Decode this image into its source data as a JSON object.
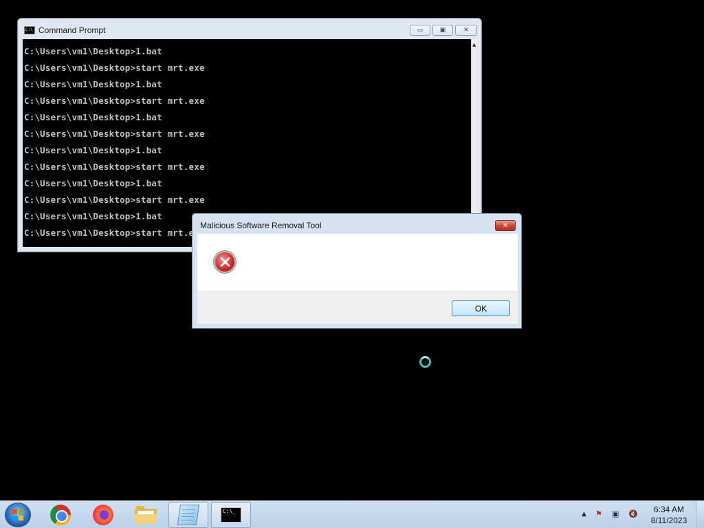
{
  "cmd_window": {
    "title": "Command Prompt",
    "icon_label": "C:\\",
    "buttons": {
      "minimize": "▭",
      "maximize": "▣",
      "close": "✕"
    },
    "lines": [
      "C:\\Users\\vm1\\Desktop>1.bat",
      "C:\\Users\\vm1\\Desktop>start mrt.exe",
      "C:\\Users\\vm1\\Desktop>1.bat",
      "C:\\Users\\vm1\\Desktop>start mrt.exe",
      "C:\\Users\\vm1\\Desktop>1.bat",
      "C:\\Users\\vm1\\Desktop>start mrt.exe",
      "C:\\Users\\vm1\\Desktop>1.bat",
      "C:\\Users\\vm1\\Desktop>start mrt.exe",
      "C:\\Users\\vm1\\Desktop>1.bat",
      "C:\\Users\\vm1\\Desktop>start mrt.exe",
      "C:\\Users\\vm1\\Desktop>1.bat",
      "C:\\Users\\vm1\\Desktop>start mrt.exe"
    ]
  },
  "dialog": {
    "title": "Malicious Software Removal Tool",
    "close_label": "✕",
    "icon": "error-icon",
    "message": "",
    "ok_label": "OK"
  },
  "taskbar": {
    "items": [
      "start-orb",
      "chrome-icon",
      "firefox-icon",
      "file-explorer-icon",
      "notepad-icon",
      "command-prompt-icon"
    ],
    "cmd_icon_label": "C:\\_",
    "tray": {
      "overflow": "▲",
      "flag": "⚑",
      "network": "▣",
      "volume": "🔇"
    },
    "time": "6:34 AM",
    "date": "8/11/2023"
  },
  "colors": {
    "desktop": "#000000",
    "console_text": "#c0c0c0",
    "dialog_frame": "#d4e2f2",
    "taskbar": "#c6d9ee"
  }
}
